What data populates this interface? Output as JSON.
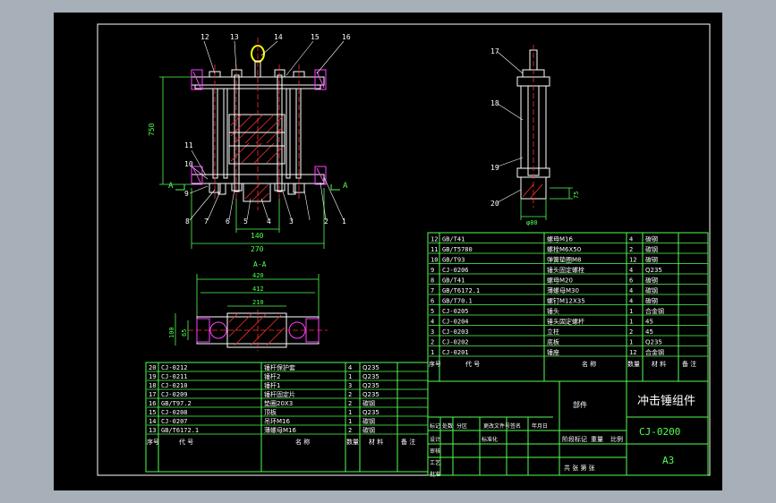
{
  "drawing": {
    "title": "冲击锤组件",
    "drawing_number": "CJ-0200",
    "sheet_size": "A3",
    "section_label": "A-A",
    "assembly_word": "部件",
    "scale_field": "比例",
    "weight_field": "重量",
    "stage_field": "阶段标记",
    "sheet_count": "共 张  第 张"
  },
  "front_view": {
    "balloons": [
      "12",
      "13",
      "14",
      "15",
      "16",
      "11",
      "10",
      "9",
      "8",
      "7",
      "6",
      "5",
      "4",
      "3",
      "2",
      "1"
    ],
    "dims": {
      "height": "750",
      "inner_width": "140",
      "outer_width": "270"
    },
    "section_mark": "A"
  },
  "side_view": {
    "balloons": [
      "17",
      "18",
      "19",
      "20"
    ],
    "dims": {
      "width": "φ80",
      "height": "75"
    }
  },
  "section_view": {
    "dims": {
      "d1": "420",
      "d2": "412",
      "d3": "210",
      "h1": "100",
      "h2": "65"
    }
  },
  "bom_right": {
    "rows": [
      [
        "12",
        "GB/T41",
        "螺母M16",
        "4",
        "碳钢"
      ],
      [
        "11",
        "GB/T5780",
        "螺栓M6X50",
        "2",
        "碳钢"
      ],
      [
        "10",
        "GB/T93",
        "弹簧垫圈M8",
        "12",
        "碳钢"
      ],
      [
        "9",
        "CJ-0206",
        "锤头固定螺栓",
        "4",
        "Q235"
      ],
      [
        "8",
        "GB/T41",
        "螺母M20",
        "6",
        "碳钢"
      ],
      [
        "7",
        "GB/T6172.1",
        "薄螺母M30",
        "4",
        "碳钢"
      ],
      [
        "6",
        "GB/T70.1",
        "螺钉M12X35",
        "4",
        "碳钢"
      ],
      [
        "5",
        "CJ-0205",
        "锤头",
        "1",
        "合金钢"
      ],
      [
        "4",
        "CJ-0204",
        "锤头固定螺杆",
        "1",
        "45"
      ],
      [
        "3",
        "CJ-0203",
        "立柱",
        "2",
        "45"
      ],
      [
        "2",
        "CJ-0202",
        "底板",
        "1",
        "Q235"
      ],
      [
        "1",
        "CJ-0201",
        "锤座",
        "12",
        "合金钢"
      ]
    ],
    "header": [
      "序号",
      "代 号",
      "名 称",
      "数量",
      "材 料",
      "备 注"
    ]
  },
  "bom_left": {
    "rows": [
      [
        "20",
        "CJ-0212",
        "锤杆保护套",
        "4",
        "Q235"
      ],
      [
        "19",
        "CJ-0211",
        "锤杆2",
        "1",
        "Q235"
      ],
      [
        "18",
        "CJ-0210",
        "锤杆1",
        "3",
        "Q235"
      ],
      [
        "17",
        "CJ-0209",
        "锤杆固定片",
        "2",
        "Q235"
      ],
      [
        "16",
        "GB/T97.2",
        "垫圈20X3",
        "2",
        "碳钢"
      ],
      [
        "15",
        "CJ-0208",
        "顶板",
        "1",
        "Q235"
      ],
      [
        "14",
        "CJ-0207",
        "吊环M16",
        "1",
        "碳钢"
      ],
      [
        "13",
        "GB/T6172.1",
        "薄螺母M16",
        "2",
        "碳钢"
      ]
    ],
    "header": [
      "序号",
      "代 号",
      "名 称",
      "数量",
      "材 料",
      "备 注"
    ]
  },
  "title_block": {
    "rev_header": [
      "标记",
      "处数",
      "分区",
      "更改文件号",
      "签名",
      "年月日"
    ],
    "row_labels": [
      "设计",
      "审核",
      "工艺",
      "批准"
    ],
    "std_label": "标准化"
  }
}
